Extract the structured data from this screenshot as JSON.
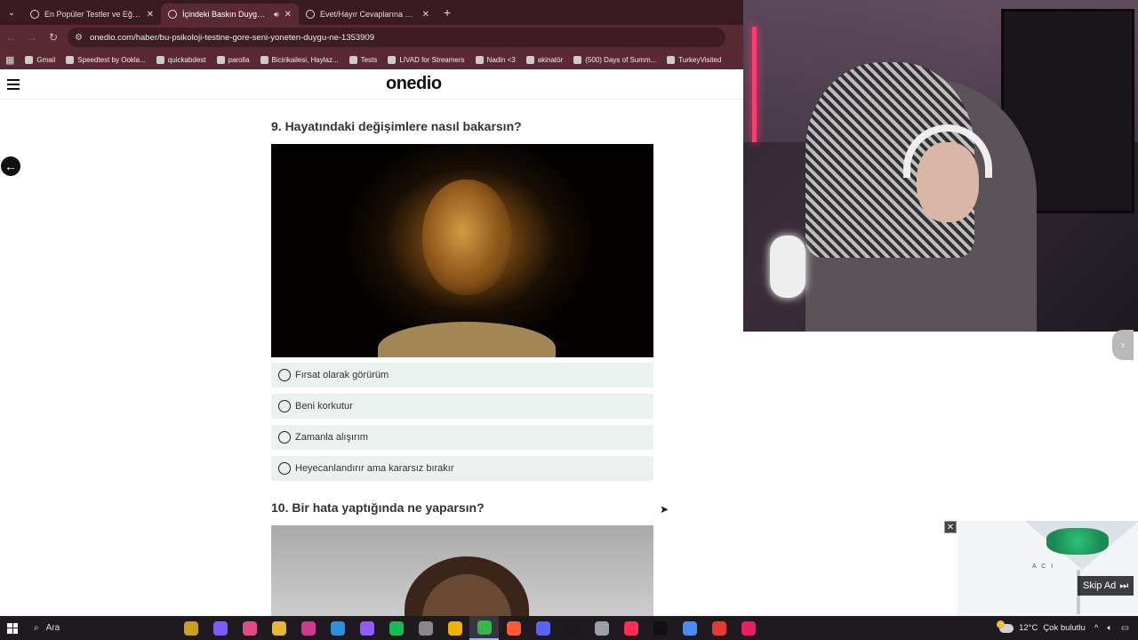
{
  "browser": {
    "tabs": [
      {
        "title": "En Popüler Testler ve Eğlenceli",
        "active": false
      },
      {
        "title": "İçindeki Baskın Duyguyu Ke",
        "active": true
      },
      {
        "title": "Evet/Hayır Cevaplarına Göre A",
        "active": false
      }
    ],
    "url": "onedio.com/haber/bu-psikoloji-testine-gore-seni-yoneten-duygu-ne-1353909",
    "bookmarks": [
      "Gmail",
      "Speedtest by Ookla...",
      "quickabdest",
      "parolla",
      "Bicirikailesi, Haylaz...",
      "Tests",
      "LIVAD for Streamers",
      "Nadin <3",
      "akinatör",
      "(500) Days of Summ...",
      "TurkeyVisited"
    ]
  },
  "site": {
    "logo": "onedio"
  },
  "quiz": {
    "q9": {
      "title": "9. Hayatındaki değişimlere nasıl bakarsın?",
      "options": [
        "Fırsat olarak görürüm",
        "Beni korkutur",
        "Zamanla alışırım",
        "Heyecanlandırır ama kararsız bırakır"
      ]
    },
    "q10": {
      "title": "10. Bir hata yaptığında ne yaparsın?"
    }
  },
  "ad": {
    "brand": "A C I",
    "skip_label": "Skip Ad",
    "close_glyph": "✕"
  },
  "taskbar": {
    "search_label": "Ara",
    "weather_temp": "12°C",
    "weather_text": "Çok bulutlu",
    "app_colors": [
      "#c8a020",
      "#7c5cff",
      "#e24a8a",
      "#e9b43a",
      "#cf3b8c",
      "#2f8fdb",
      "#8e5cff",
      "#1db954",
      "#888888",
      "#f0b400",
      "#39b54a",
      "#ff5a36",
      "#5865f2",
      "#1a1a1a",
      "#9aa0a6",
      "#ff2d55",
      "#111111",
      "#4a8df0",
      "#e53935",
      "#e91e63"
    ]
  },
  "colors": {
    "chrome_bg": "#5a2a34",
    "tabbar_bg": "#3a1b22",
    "option_bg": "#eaf1ef"
  }
}
